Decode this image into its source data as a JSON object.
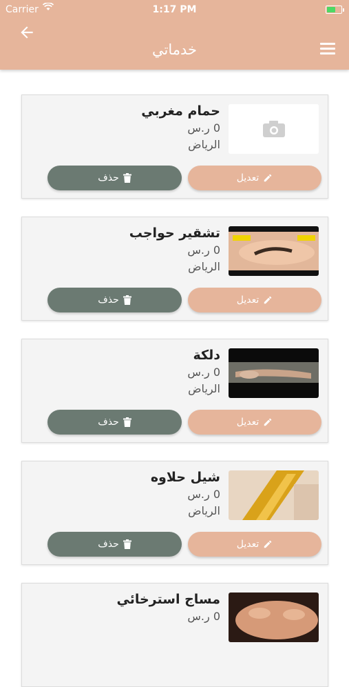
{
  "status_bar": {
    "carrier": "Carrier",
    "time": "1:17 PM"
  },
  "header": {
    "title": "خدماتي"
  },
  "colors": {
    "accent": "#e6b59b",
    "delete": "#6b7a72"
  },
  "services": [
    {
      "name": "حمام مغربي",
      "price": "0 ر.س",
      "city": "الرياض",
      "edit_label": "تعديل",
      "delete_label": "حذف",
      "image": "camera-placeholder"
    },
    {
      "name": "تشقير حواجب",
      "price": "0 ر.س",
      "city": "الرياض",
      "edit_label": "تعديل",
      "delete_label": "حذف",
      "image": "brow-tint-photo"
    },
    {
      "name": "دلكة",
      "price": "0 ر.س",
      "city": "الرياض",
      "edit_label": "تعديل",
      "delete_label": "حذف",
      "image": "scrub-photo"
    },
    {
      "name": "شيل حلاوه",
      "price": "0 ر.س",
      "city": "الرياض",
      "edit_label": "تعديل",
      "delete_label": "حذف",
      "image": "sugaring-photo"
    },
    {
      "name": "مساج استرخائي",
      "price": "0 ر.س",
      "city": "",
      "edit_label": "",
      "delete_label": "",
      "image": "massage-photo"
    }
  ]
}
